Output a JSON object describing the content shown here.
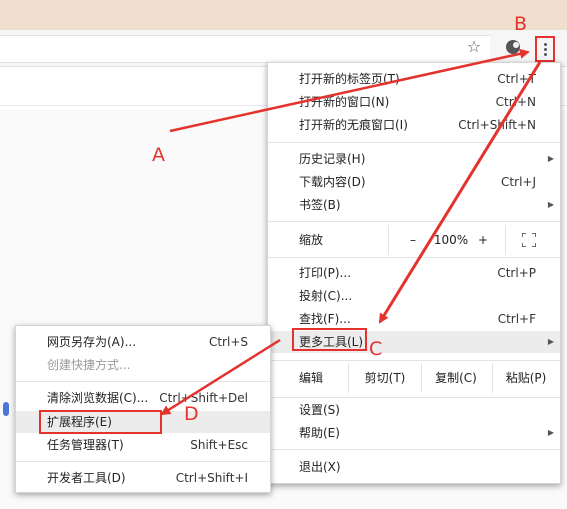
{
  "browser": {
    "star_glyph": "☆"
  },
  "main_menu": {
    "items_top": [
      {
        "label": "打开新的标签页(T)",
        "shortcut": "Ctrl+T"
      },
      {
        "label": "打开新的窗口(N)",
        "shortcut": "Ctrl+N"
      },
      {
        "label": "打开新的无痕窗口(I)",
        "shortcut": "Ctrl+Shift+N"
      }
    ],
    "history": {
      "label": "历史记录(H)"
    },
    "downloads": {
      "label": "下载内容(D)",
      "shortcut": "Ctrl+J"
    },
    "bookmarks": {
      "label": "书签(B)"
    },
    "zoom": {
      "label": "缩放",
      "minus": "–",
      "value": "100%",
      "plus": "+"
    },
    "print": {
      "label": "打印(P)...",
      "shortcut": "Ctrl+P"
    },
    "cast": {
      "label": "投射(C)..."
    },
    "find": {
      "label": "查找(F)...",
      "shortcut": "Ctrl+F"
    },
    "more_tools": {
      "label": "更多工具(L)"
    },
    "edit": {
      "label": "编辑",
      "cut": "剪切(T)",
      "copy": "复制(C)",
      "paste": "粘贴(P)"
    },
    "settings": {
      "label": "设置(S)"
    },
    "help": {
      "label": "帮助(E)"
    },
    "exit": {
      "label": "退出(X)"
    }
  },
  "sub_menu": {
    "save_page": {
      "label": "网页另存为(A)...",
      "shortcut": "Ctrl+S"
    },
    "create_shortcut": {
      "label": "创建快捷方式..."
    },
    "clear_data": {
      "label": "清除浏览数据(C)...",
      "shortcut": "Ctrl+Shift+Del"
    },
    "extensions": {
      "label": "扩展程序(E)"
    },
    "task_manager": {
      "label": "任务管理器(T)",
      "shortcut": "Shift+Esc"
    },
    "dev_tools": {
      "label": "开发者工具(D)",
      "shortcut": "Ctrl+Shift+I"
    }
  },
  "annotations": {
    "a": "A",
    "b": "B",
    "c": "C",
    "d": "D"
  },
  "colors": {
    "annotation_red": "#e5322d"
  }
}
